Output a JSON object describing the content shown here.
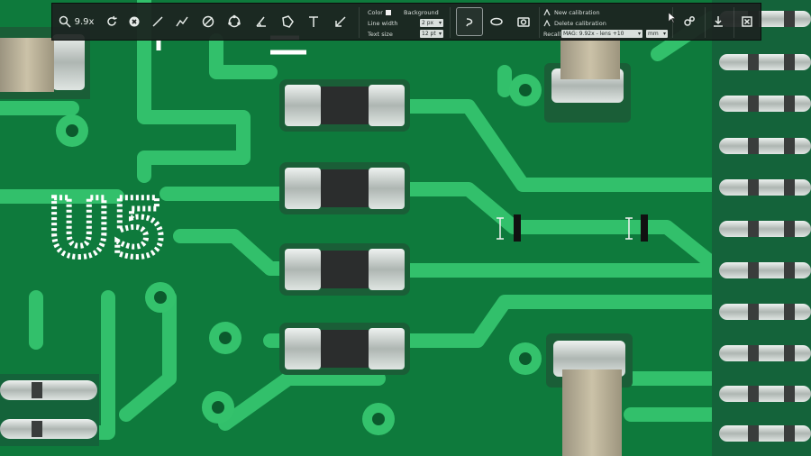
{
  "toolbar": {
    "zoom_value": "9.9x",
    "tools": [
      {
        "name": "magnifier-icon"
      },
      {
        "name": "refresh-icon"
      },
      {
        "name": "clear-icon"
      },
      {
        "name": "line-icon"
      },
      {
        "name": "polyline-icon"
      },
      {
        "name": "circle-diameter-icon"
      },
      {
        "name": "three-point-circle-icon"
      },
      {
        "name": "angle-icon"
      },
      {
        "name": "polygon-icon"
      },
      {
        "name": "text-icon"
      },
      {
        "name": "arrow-icon"
      }
    ],
    "style_panel": {
      "color_label": "Color",
      "background_label": "Background",
      "line_width_label": "Line width",
      "line_width_value": "2 px",
      "text_size_label": "Text size",
      "text_size_value": "12 pt"
    },
    "mode_buttons": [
      {
        "name": "lasso-tool-icon"
      },
      {
        "name": "ellipse-tool-icon"
      },
      {
        "name": "camera-icon"
      }
    ],
    "calibration": {
      "new_label": "New calibration",
      "delete_label": "Delete calibration",
      "recall_label": "Recall",
      "recall_value": "MAG: 9.92x - lens +10",
      "unit_value": "mm"
    },
    "right_buttons": [
      {
        "name": "settings-icon"
      },
      {
        "name": "download-icon"
      },
      {
        "name": "close-icon"
      }
    ]
  },
  "board": {
    "silkscreen_label": "U5",
    "colors": {
      "board": "#0f7a3d",
      "trace": "#2fbf69",
      "pad": "#cfd6d2",
      "silkscreen": "#ffffff"
    }
  }
}
